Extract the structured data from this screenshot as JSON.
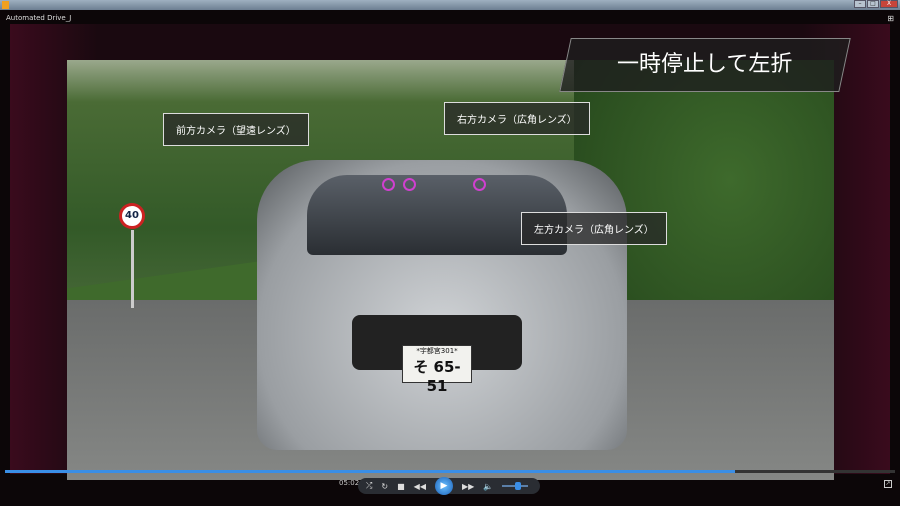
{
  "window": {
    "minimize": "–",
    "maximize": "□",
    "close": "X"
  },
  "player": {
    "media_title": "Automated Drive_J",
    "time": "05:02",
    "progress_percent": 82,
    "volume_percent": 60
  },
  "video": {
    "heading": "一時停止して左折",
    "callouts": [
      "前方カメラ（望遠レンズ）",
      "右方カメラ（広角レンズ）",
      "左方カメラ（広角レンズ）"
    ],
    "speed_sign": "40",
    "plate_top": "*宇都宮301*",
    "plate_main": "そ 65-51"
  },
  "controls": {
    "shuffle": "⤮",
    "repeat": "↻",
    "stop": "■",
    "prev": "◀◀",
    "play": "▶",
    "next": "▶▶",
    "mute": "🔈"
  }
}
